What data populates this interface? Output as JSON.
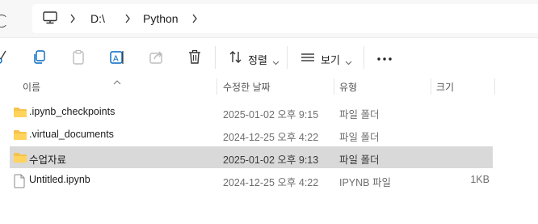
{
  "address": {
    "pc_icon": "computer-icon",
    "segments": [
      "D:\\",
      "Python"
    ]
  },
  "toolbar": {
    "sort_label": "정렬",
    "view_label": "보기",
    "icons": [
      "cut-icon",
      "copy-icon",
      "paste-icon",
      "rename-icon",
      "share-icon",
      "delete-icon",
      "sort-icon",
      "view-icon",
      "more-icon"
    ]
  },
  "columns": {
    "name": "이름",
    "date": "수정한 날짜",
    "type": "유형",
    "size": "크기"
  },
  "files": [
    {
      "name": ".ipynb_checkpoints",
      "date": "2025-01-02 오후 9:15",
      "type": "파일 폴더",
      "size": "",
      "kind": "folder",
      "selected": false
    },
    {
      "name": ".virtual_documents",
      "date": "2024-12-25 오후 4:22",
      "type": "파일 폴더",
      "size": "",
      "kind": "folder",
      "selected": false
    },
    {
      "name": "수업자료",
      "date": "2025-01-02 오후 9:13",
      "type": "파일 폴더",
      "size": "",
      "kind": "folder",
      "selected": true
    },
    {
      "name": "Untitled.ipynb",
      "date": "2024-12-25 오후 4:22",
      "type": "IPYNB 파일",
      "size": "1KB",
      "kind": "file",
      "selected": false
    }
  ],
  "colors": {
    "selected_row": "#d9d9d9",
    "folder": "#f6c34a",
    "accent": "#0067c0"
  }
}
